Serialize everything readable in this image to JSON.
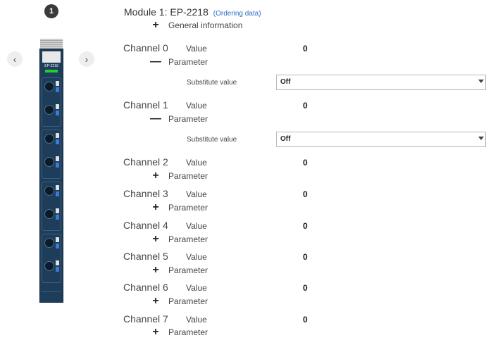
{
  "badge_number": "1",
  "nav": {
    "prev_icon": "chevron-left-icon",
    "next_icon": "chevron-right-icon",
    "prev_glyph": "‹",
    "next_glyph": "›"
  },
  "module_name_on_device": "EP-2218",
  "module_title": "Module 1: EP-2218",
  "ordering_link": "(Ordering data)",
  "general_information": "General information",
  "toggle_plus": "+",
  "toggle_minus": "—",
  "channels": [
    {
      "name": "Channel 0",
      "value_label": "Value",
      "value": "0",
      "parameter_label": "Parameter",
      "expanded": true,
      "substitute_label": "Substitute value",
      "substitute_value": "Off"
    },
    {
      "name": "Channel 1",
      "value_label": "Value",
      "value": "0",
      "parameter_label": "Parameter",
      "expanded": true,
      "substitute_label": "Substitute value",
      "substitute_value": "Off"
    },
    {
      "name": "Channel 2",
      "value_label": "Value",
      "value": "0",
      "parameter_label": "Parameter",
      "expanded": false
    },
    {
      "name": "Channel 3",
      "value_label": "Value",
      "value": "0",
      "parameter_label": "Parameter",
      "expanded": false
    },
    {
      "name": "Channel 4",
      "value_label": "Value",
      "value": "0",
      "parameter_label": "Parameter",
      "expanded": false
    },
    {
      "name": "Channel 5",
      "value_label": "Value",
      "value": "0",
      "parameter_label": "Parameter",
      "expanded": false
    },
    {
      "name": "Channel 6",
      "value_label": "Value",
      "value": "0",
      "parameter_label": "Parameter",
      "expanded": false
    },
    {
      "name": "Channel 7",
      "value_label": "Value",
      "value": "0",
      "parameter_label": "Parameter",
      "expanded": false
    }
  ],
  "colors": {
    "link": "#2a6fc4",
    "module_body": "#1e3d5a",
    "led": "#22cc33"
  }
}
